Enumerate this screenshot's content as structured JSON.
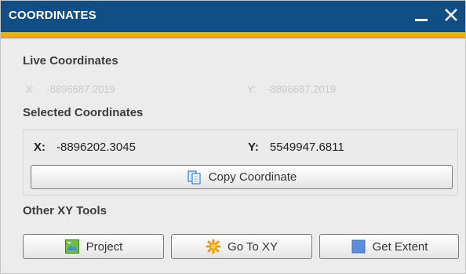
{
  "window": {
    "title": "COORDINATES",
    "minimize_icon": "minimize-icon",
    "close_icon": "close-icon",
    "colors": {
      "titlebar": "#124e86",
      "accent": "#f0ad14",
      "body": "#ececec"
    }
  },
  "live": {
    "heading": "Live Coordinates",
    "x_label": "X:",
    "x_value": "-8896687.2019",
    "y_label": "Y:",
    "y_value": "-8896687.2019"
  },
  "selected": {
    "heading": "Selected Coordinates",
    "x_label": "X:",
    "x_value": "-8896202.3045",
    "y_label": "Y:",
    "y_value": "5549947.6811",
    "copy_button": {
      "label": "Copy Coordinate",
      "icon": "copy-icon"
    }
  },
  "tools": {
    "heading": "Other XY Tools",
    "buttons": [
      {
        "label": "Project",
        "icon": "map-project-icon"
      },
      {
        "label": "Go To XY",
        "icon": "star-burst-icon"
      },
      {
        "label": "Get Extent",
        "icon": "square-extent-icon"
      }
    ]
  }
}
